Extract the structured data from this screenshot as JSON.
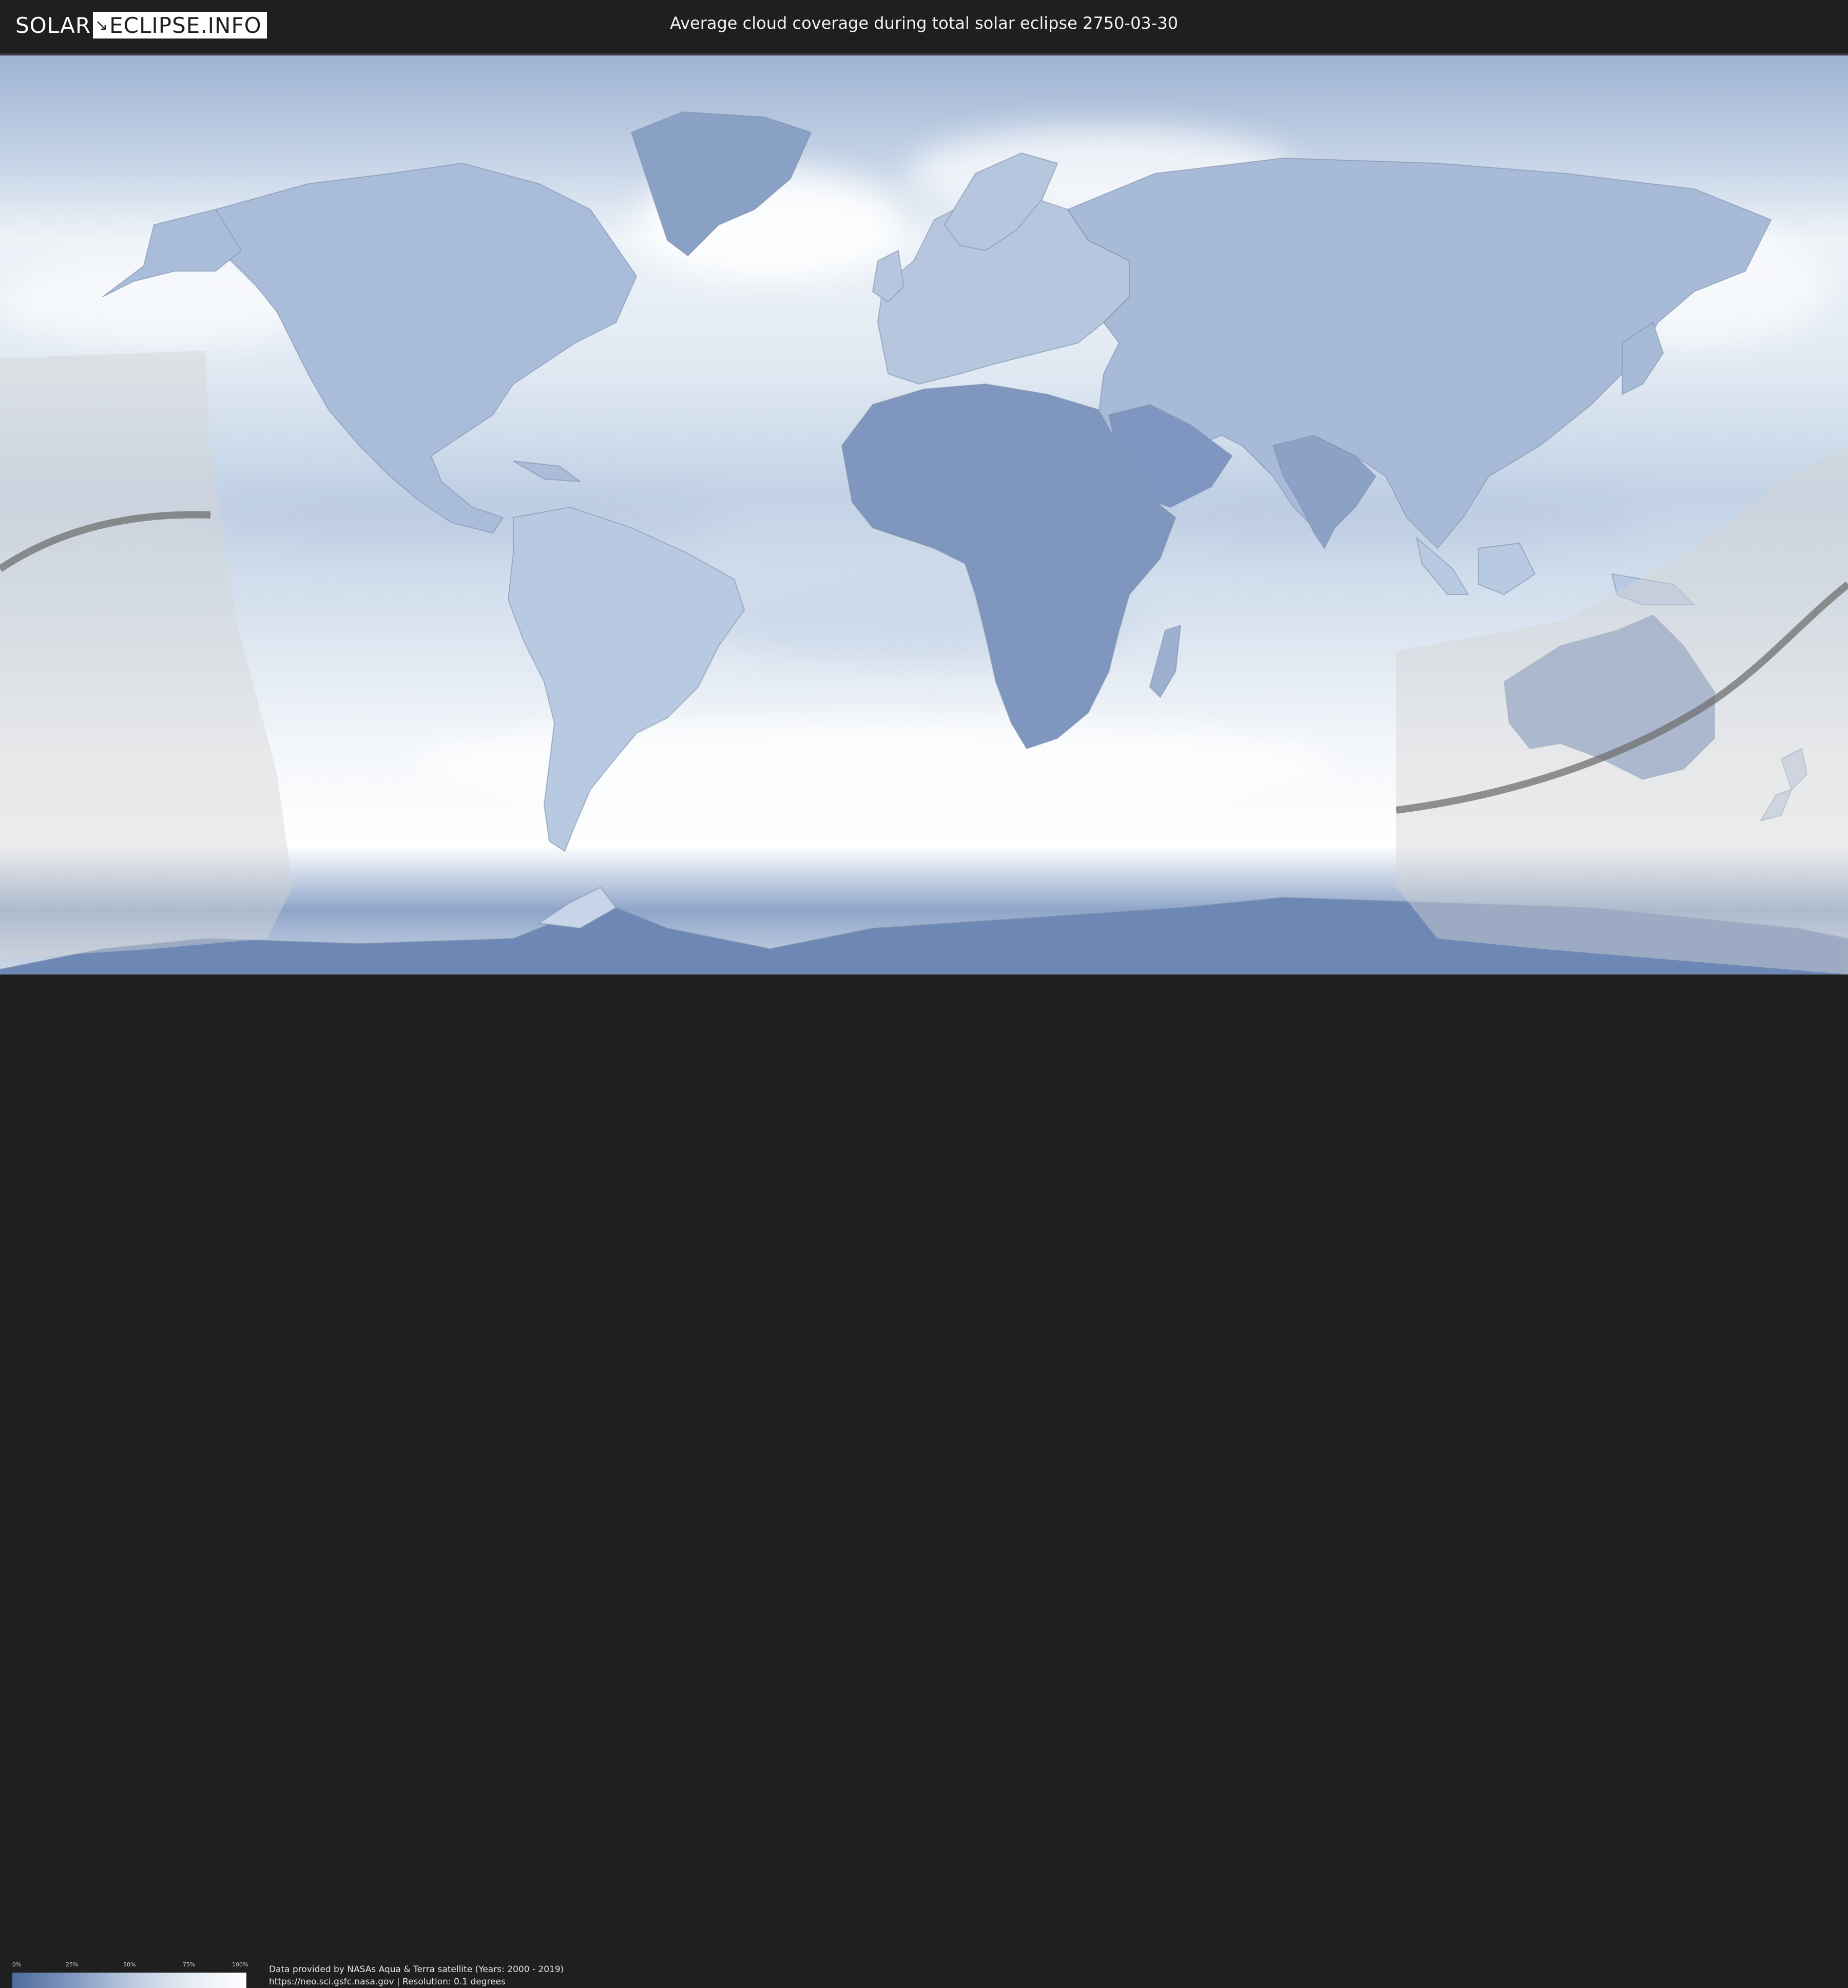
{
  "header": {
    "logo_text_left": "SOLAR",
    "logo_text_right": "ECLIPSE.INFO",
    "title": "Average cloud coverage during total solar eclipse 2750-03-30"
  },
  "legend": {
    "ticks": [
      "0%",
      "25%",
      "50%",
      "75%",
      "100%"
    ],
    "colors": [
      "#4f6a9e",
      "#7f98c0",
      "#b9c8df",
      "#e4ebf4",
      "#ffffff"
    ]
  },
  "credits": {
    "line1": "Data provided by NASAs Aqua & Terra satellite (Years: 2000 - 2019)",
    "line2": "https://neo.sci.gsfc.nasa.gov | Resolution: 0.1 degrees"
  },
  "map": {
    "projection": "equirectangular",
    "ocean_color": "#dfe8f2",
    "cloud_low_color": "#5f7cab",
    "cloud_high_color": "#ffffff",
    "eclipse_path_color": "#6f6f6f",
    "visibility_zone_color": "#d0d0d0"
  }
}
